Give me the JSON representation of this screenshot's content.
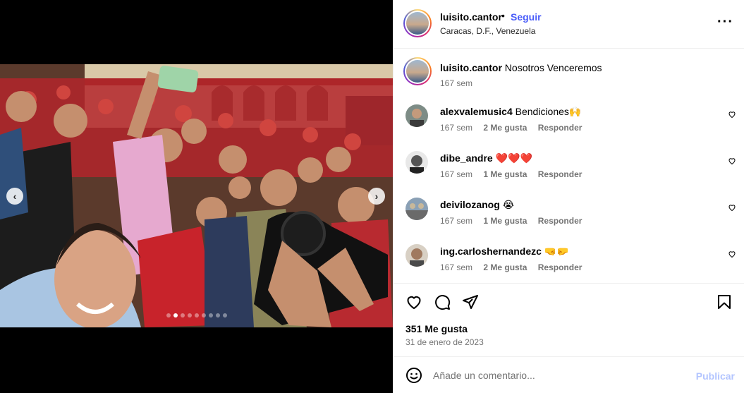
{
  "post": {
    "author": "luisito.cantor",
    "separator": "•",
    "follow_label": "Seguir",
    "location": "Caracas, D.F., Venezuela",
    "more_icon": "more-horizontal-icon",
    "carousel": {
      "total_slides": 9,
      "active_slide": 2
    }
  },
  "caption": {
    "author": "luisito.cantor",
    "text": "Nosotros Venceremos",
    "time": "167 sem"
  },
  "comments": [
    {
      "user": "alexvalemusic4",
      "text": "Bendiciones🙌",
      "time": "167 sem",
      "likes": "2 Me gusta",
      "reply": "Responder"
    },
    {
      "user": "dibe_andre",
      "text": "❤️❤️❤️",
      "time": "167 sem",
      "likes": "1 Me gusta",
      "reply": "Responder"
    },
    {
      "user": "deivilozanog",
      "text": "😭",
      "time": "167 sem",
      "likes": "1 Me gusta",
      "reply": "Responder"
    },
    {
      "user": "ing.carloshernandezc",
      "text": "🤜🤛",
      "time": "167 sem",
      "likes": "2 Me gusta",
      "reply": "Responder"
    }
  ],
  "actions": {
    "likes": "351 Me gusta",
    "date": "31 de enero de 2023"
  },
  "add_comment": {
    "placeholder": "Añade un comentario...",
    "publish_label": "Publicar"
  },
  "colors": {
    "follow": "#4a5df9",
    "publish_disabled": "#b3c5ff",
    "meta_text": "#737373",
    "heart_red": "#e0242f"
  }
}
